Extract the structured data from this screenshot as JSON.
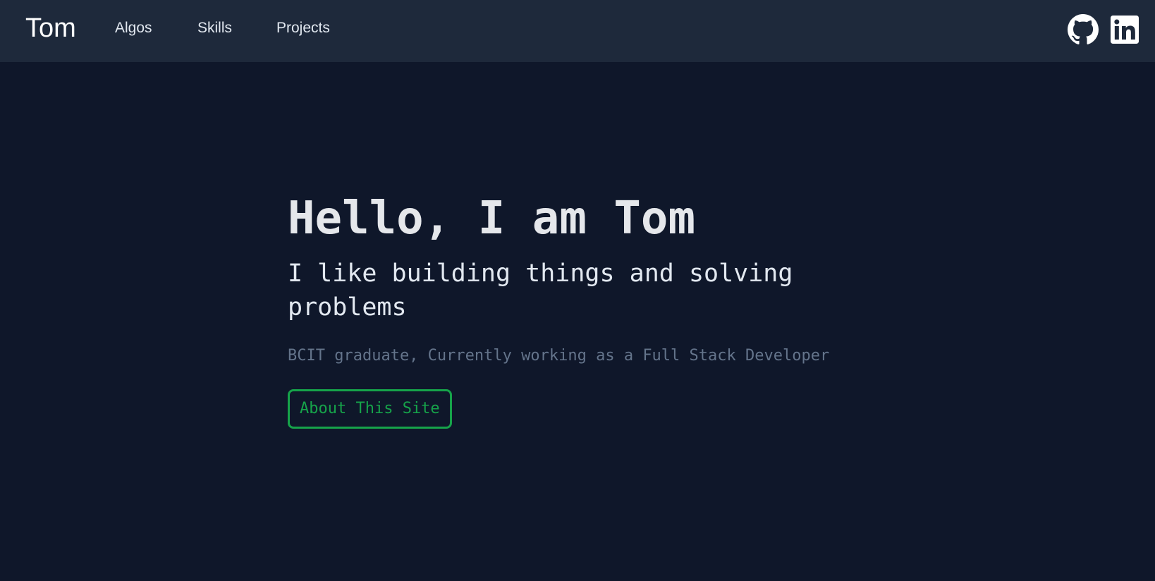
{
  "navbar": {
    "brand": "Tom",
    "links": [
      {
        "label": "Algos"
      },
      {
        "label": "Skills"
      },
      {
        "label": "Projects"
      }
    ],
    "social": [
      {
        "icon": "github-icon"
      },
      {
        "icon": "linkedin-icon"
      }
    ]
  },
  "hero": {
    "title": "Hello, I am Tom",
    "subtitle": "I like building things and solving problems",
    "description": "BCIT graduate, Currently working as a Full Stack Developer",
    "button_label": "About This Site"
  },
  "colors": {
    "page_background": "#0f172a",
    "navbar_background": "#1e293b",
    "accent": "#16a34a",
    "muted_text": "#64748b"
  }
}
